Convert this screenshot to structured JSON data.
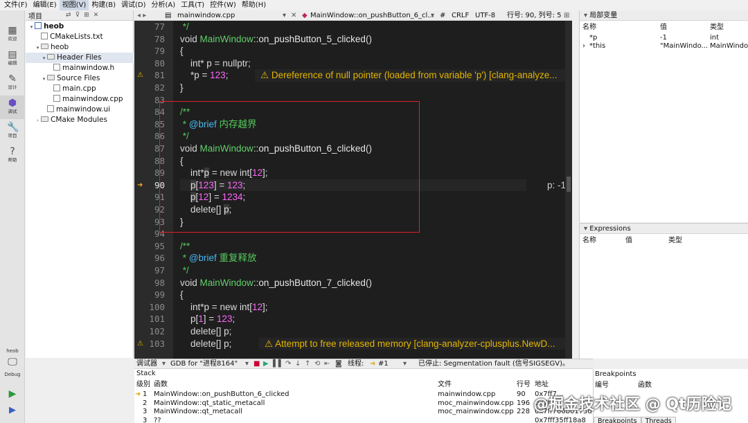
{
  "menu": [
    "文件(F)",
    "编辑(E)",
    "视图(V)",
    "构建(B)",
    "调试(D)",
    "分析(A)",
    "工具(T)",
    "控件(W)",
    "帮助(H)"
  ],
  "modes": [
    "欢迎",
    "编辑",
    "设计",
    "调试",
    "项目",
    "帮助"
  ],
  "kit": {
    "project": "heob",
    "mode": "Debug"
  },
  "project_panel": {
    "title": "项目"
  },
  "tree": [
    {
      "label": "heob",
      "level": 0,
      "kind": "project",
      "arrow": "▾"
    },
    {
      "label": "CMakeLists.txt",
      "level": 1,
      "kind": "file",
      "arrow": ""
    },
    {
      "label": "heob",
      "level": 1,
      "kind": "folder",
      "arrow": "▾"
    },
    {
      "label": "Header Files",
      "level": 2,
      "kind": "folder",
      "arrow": "▾"
    },
    {
      "label": "mainwindow.h",
      "level": 3,
      "kind": "file",
      "arrow": ""
    },
    {
      "label": "Source Files",
      "level": 2,
      "kind": "folder",
      "arrow": "▾"
    },
    {
      "label": "main.cpp",
      "level": 3,
      "kind": "file",
      "arrow": ""
    },
    {
      "label": "mainwindow.cpp",
      "level": 3,
      "kind": "file",
      "arrow": ""
    },
    {
      "label": "mainwindow.ui",
      "level": 2,
      "kind": "file",
      "arrow": ""
    },
    {
      "label": "CMake Modules",
      "level": 1,
      "kind": "folder",
      "arrow": "›"
    }
  ],
  "editor_bar": {
    "file": "mainwindow.cpp",
    "symbol": "MainWindow::on_pushButton_6_cl...",
    "hash": "#",
    "line_ending": "CRLF",
    "encoding": "UTF-8",
    "position": "行号: 90, 列号: 5"
  },
  "code": [
    {
      "n": "77",
      "html": "<span class=\"cm\"> */</span>"
    },
    {
      "n": "78",
      "html": "<span class=\"kw\">void</span> <span class=\"cls\">MainWindow</span>::<span class=\"fn\">on_pushButton_5_clicked</span>()"
    },
    {
      "n": "79",
      "html": "{"
    },
    {
      "n": "80",
      "html": "    <span class=\"ty\">int</span>* p = <span class=\"kw\">nullptr</span>;"
    },
    {
      "n": "81",
      "html": "    *p = <span class=\"num\">123</span>;",
      "mark": "warn"
    },
    {
      "n": "82",
      "html": "}"
    },
    {
      "n": "83",
      "html": ""
    },
    {
      "n": "84",
      "html": "<span class=\"cm\">/**</span>"
    },
    {
      "n": "85",
      "html": "<span class=\"cm\"> * </span><span class=\"tag\">@brief</span><span class=\"cm\"> 内存越界</span>"
    },
    {
      "n": "86",
      "html": "<span class=\"cm\"> */</span>"
    },
    {
      "n": "87",
      "html": "<span class=\"kw\">void</span> <span class=\"cls\">MainWindow</span>::<span class=\"fn\">on_pushButton_6_clicked</span>()"
    },
    {
      "n": "88",
      "html": "{"
    },
    {
      "n": "89",
      "html": "    <span class=\"ty\">int</span>*<span class=\"varhl\">p</span> = <span class=\"kw\">new</span> <span class=\"ty\">int</span>[<span class=\"num\">12</span>];"
    },
    {
      "n": "90",
      "html": "    <span class=\"varhl\">p</span>[<span class=\"num\">123</span>] = <span class=\"num\">123</span>;",
      "mark": "cur"
    },
    {
      "n": "91",
      "html": "    <span class=\"varhl\">p</span>[<span class=\"num\">12</span>] = <span class=\"num\">1234</span>;"
    },
    {
      "n": "92",
      "html": "    <span class=\"kw\">delete</span>[] <span class=\"varhl\">p</span>;"
    },
    {
      "n": "93",
      "html": "}"
    },
    {
      "n": "94",
      "html": ""
    },
    {
      "n": "95",
      "html": "<span class=\"cm\">/**</span>"
    },
    {
      "n": "96",
      "html": "<span class=\"cm\"> * </span><span class=\"tag\">@brief</span><span class=\"cm\"> 重复释放</span>"
    },
    {
      "n": "97",
      "html": "<span class=\"cm\"> */</span>"
    },
    {
      "n": "98",
      "html": "<span class=\"kw\">void</span> <span class=\"cls\">MainWindow</span>::<span class=\"fn\">on_pushButton_7_clicked</span>()"
    },
    {
      "n": "99",
      "html": "{"
    },
    {
      "n": "100",
      "html": "    <span class=\"ty\">int</span>*p = <span class=\"kw\">new</span> <span class=\"ty\">int</span>[<span class=\"num\">12</span>];"
    },
    {
      "n": "101",
      "html": "    p[<span class=\"num\">1</span>] = <span class=\"num\">123</span>;"
    },
    {
      "n": "102",
      "html": "    <span class=\"kw\">delete</span>[] p;"
    },
    {
      "n": "103",
      "html": "    <span class=\"kw\">delete</span>[] p;",
      "mark": "warn"
    }
  ],
  "annotations": {
    "line81": "⚠ Dereference of null pointer (loaded from variable 'p') [clang-analyze...",
    "line90": "p: -1",
    "line103": "⚠ Attempt to free released memory [clang-analyzer-cplusplus.NewD..."
  },
  "locals": {
    "title": "局部变量",
    "headers": [
      "名称",
      "值",
      "类型"
    ],
    "rows": [
      {
        "name": "*p",
        "value": "-1",
        "type": "int",
        "arrow": ""
      },
      {
        "name": "*this",
        "value": "\"MainWindo...",
        "type": "MainWindow",
        "arrow": "›"
      }
    ]
  },
  "expressions": {
    "title": "Expressions",
    "headers": [
      "名称",
      "值",
      "类型"
    ]
  },
  "debug_bar": {
    "label": "调试器",
    "engine": "GDB for \"进程8164\"",
    "thread_label": "线程:",
    "thread": "#1",
    "status": "已停止: Segmentation fault (信号SIGSEGV)。"
  },
  "stack": {
    "title": "Stack",
    "headers": [
      "级别",
      "函数",
      "文件",
      "行号",
      "地址"
    ],
    "rows": [
      {
        "level": "1",
        "func": "MainWindow::on_pushButton_6_clicked",
        "file": "mainwindow.cpp",
        "line": "90",
        "addr": "0x7ff7..."
      },
      {
        "level": "2",
        "func": "MainWindow::qt_static_metacall",
        "file": "moc_mainwindow.cpp",
        "line": "196",
        "addr": "0x7ff7..."
      },
      {
        "level": "3",
        "func": "MainWindow::qt_metacall",
        "file": "moc_mainwindow.cpp",
        "line": "228",
        "addr": "0x7ff766b0173d"
      },
      {
        "level": "3",
        "func": "??",
        "file": "",
        "line": "",
        "addr": "0x7fff35ff18a8"
      }
    ]
  },
  "breakpoints": {
    "title": "Breakpoints",
    "headers": [
      "编号",
      "函数"
    ],
    "tabs": [
      "Breakpoints",
      "Threads"
    ]
  },
  "watermark": "@掘金技术社区 @ Qt历险记"
}
